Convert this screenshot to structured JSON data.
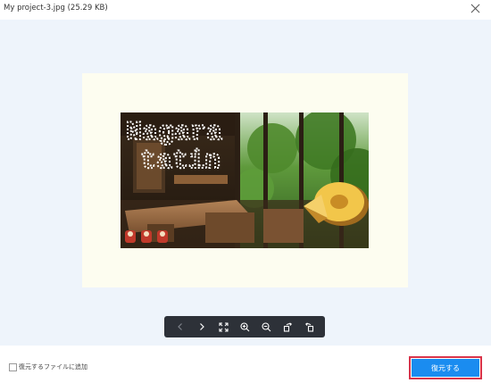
{
  "window": {
    "title": "My project-3.jpg (25.29 KB)"
  },
  "preview": {
    "overlay_text_line1": "Nagara",
    "overlay_text_line2": "tatin"
  },
  "toolbar": {
    "buttons": [
      {
        "icon": "chevron-left-icon",
        "enabled": false
      },
      {
        "icon": "chevron-right-icon",
        "enabled": true
      },
      {
        "icon": "fit-screen-icon",
        "enabled": true
      },
      {
        "icon": "zoom-in-icon",
        "enabled": true
      },
      {
        "icon": "zoom-out-icon",
        "enabled": true
      },
      {
        "icon": "rotate-right-icon",
        "enabled": true
      },
      {
        "icon": "rotate-left-icon",
        "enabled": true
      }
    ]
  },
  "footer": {
    "add_to_restore_label": "復元するファイルに追加",
    "add_to_restore_checked": false,
    "restore_button_label": "復元する"
  },
  "colors": {
    "accent": "#1a8cf0",
    "highlight_border": "#d9344a",
    "stage_bg": "#eef4fb",
    "paper_bg": "#fdfdf0",
    "toolbar_bg": "#2d3138"
  }
}
